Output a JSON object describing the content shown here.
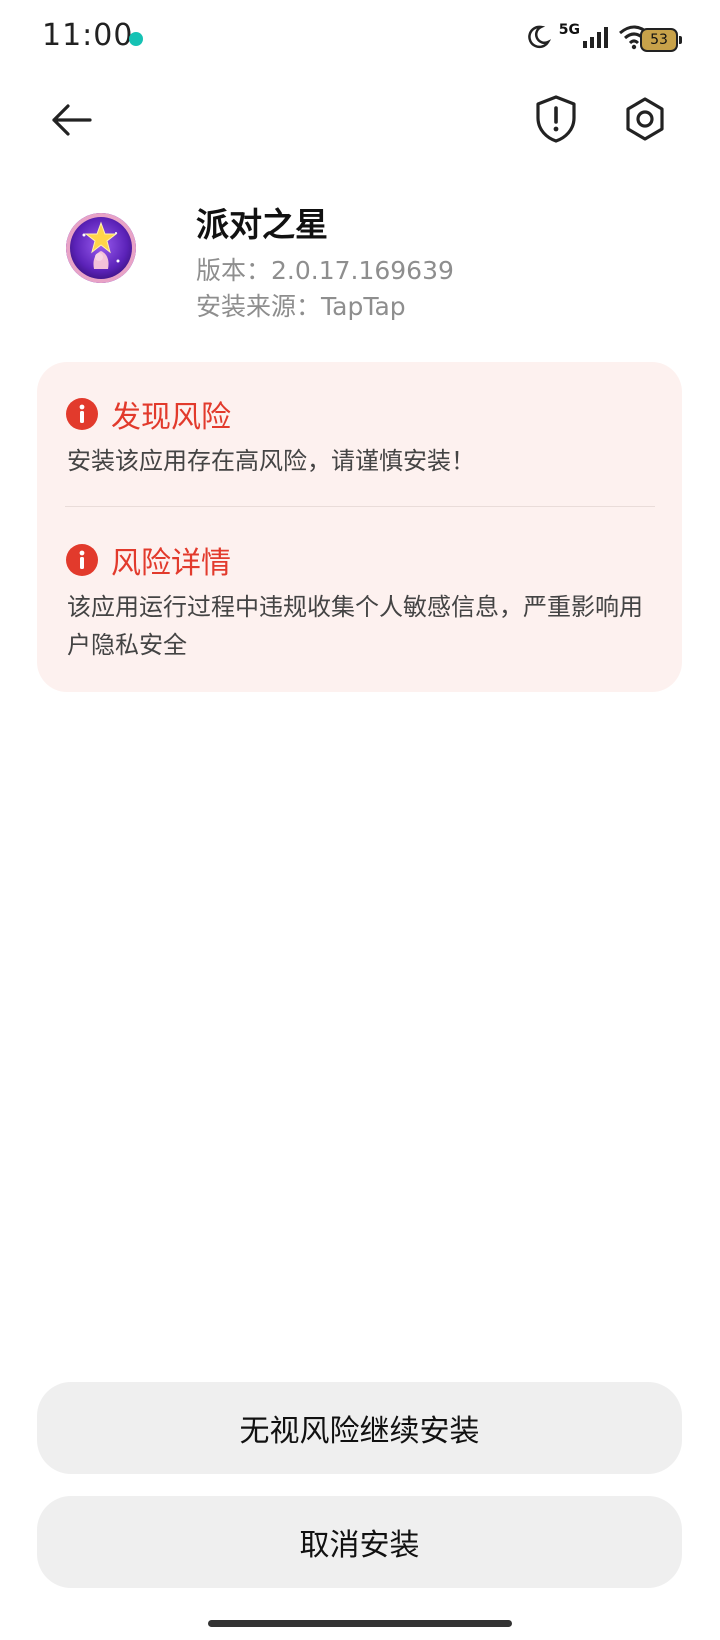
{
  "status_bar": {
    "time": "11:00",
    "network": "5G",
    "battery": "53",
    "icons": [
      "taptap-notification-icon",
      "moon-icon",
      "signal-icon",
      "wifi-icon",
      "battery-icon"
    ]
  },
  "nav": {
    "icons": [
      "back-arrow-icon",
      "shield-alert-icon",
      "settings-gear-icon"
    ]
  },
  "app": {
    "name": "派对之星",
    "version": "版本：2.0.17.169639",
    "source": "安装来源：TapTap"
  },
  "risk": {
    "found_title": "发现风险",
    "found_desc": "安装该应用存在高风险，请谨慎安装！",
    "detail_title": "风险详情",
    "detail_desc": "该应用运行过程中违规收集个人敏感信息，严重影响用户隐私安全"
  },
  "buttons": {
    "continue_label": "无视风险继续安装",
    "cancel_label": "取消安装"
  },
  "colors": {
    "risk_red": "#e23a2c",
    "risk_card_bg": "#fdf1ef",
    "button_bg": "#efefef"
  }
}
